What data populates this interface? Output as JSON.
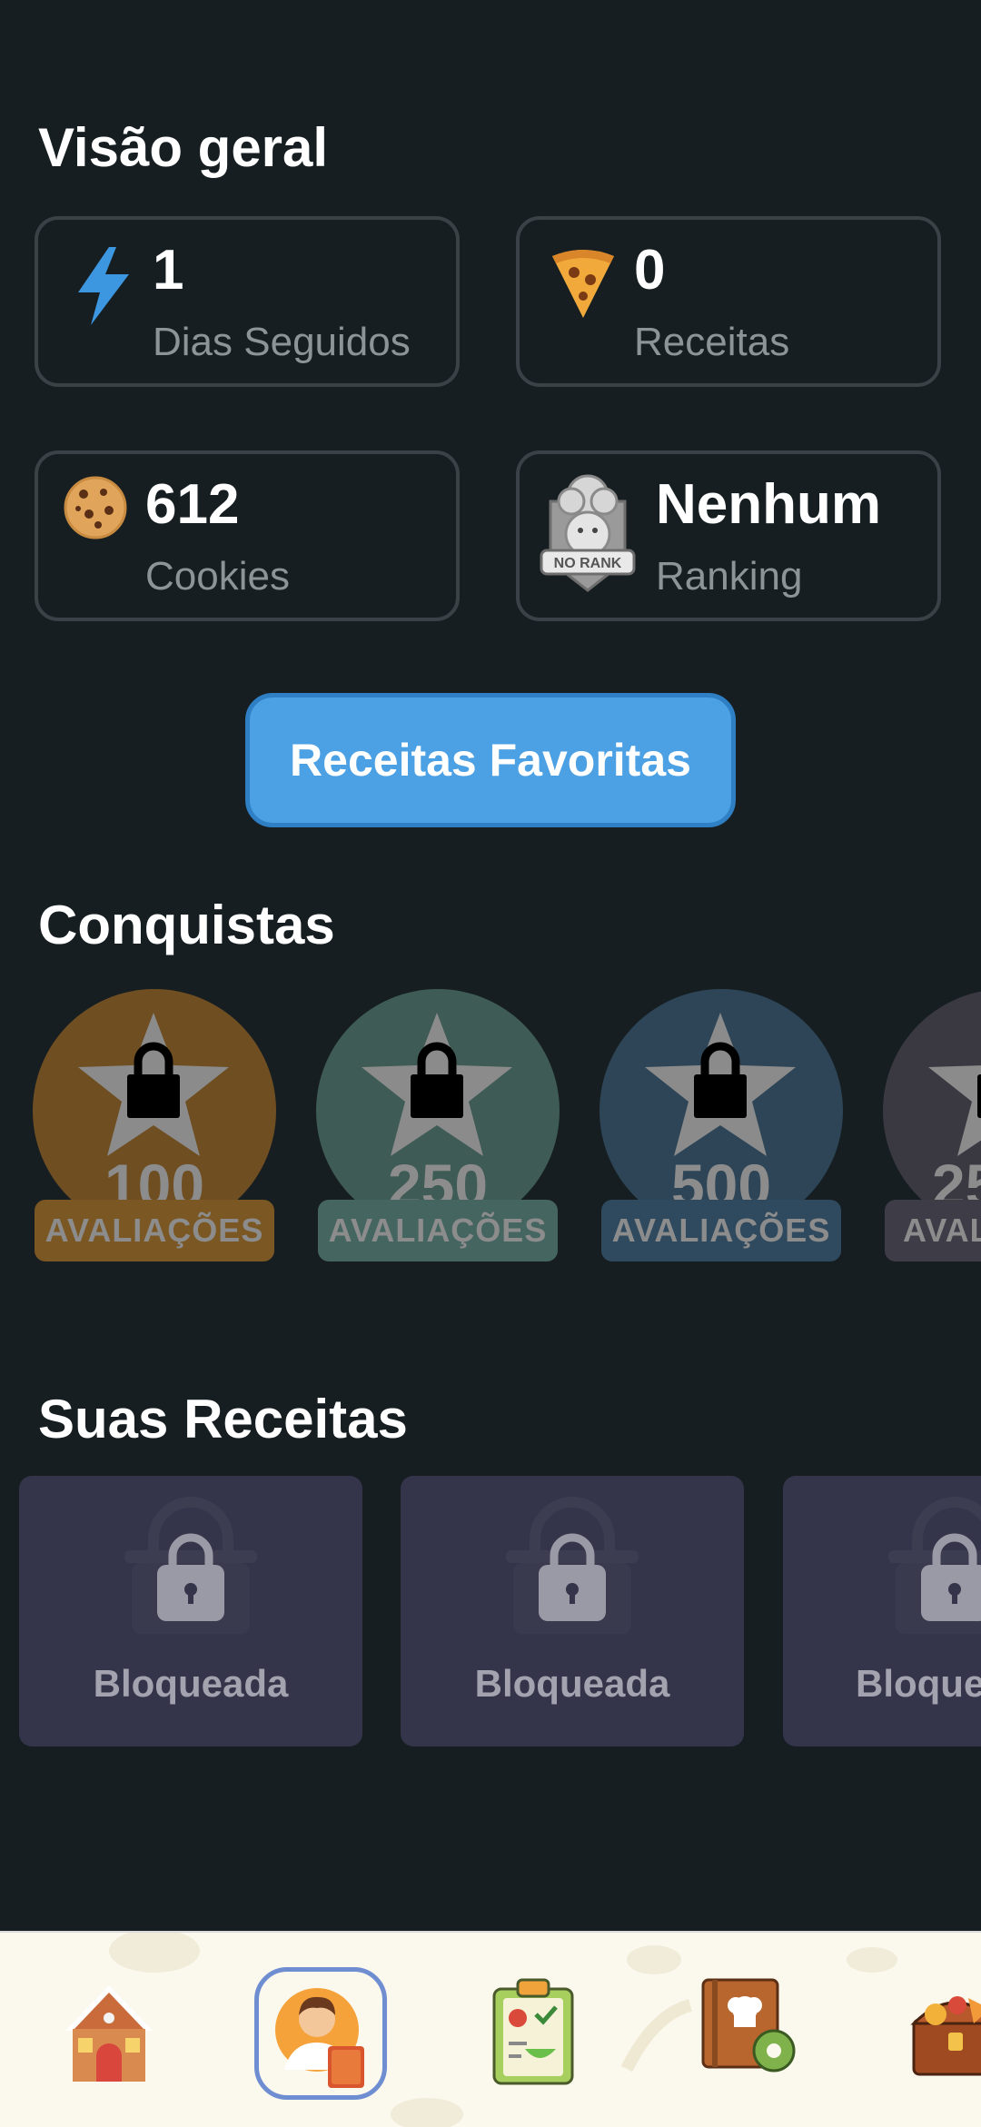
{
  "overview": {
    "title": "Visão geral",
    "stats": [
      {
        "value": "1",
        "label": "Dias Seguidos",
        "icon": "lightning-icon"
      },
      {
        "value": "0",
        "label": "Receitas",
        "icon": "pizza-icon"
      },
      {
        "value": "612",
        "label": "Cookies",
        "icon": "cookie-icon"
      },
      {
        "value": "Nenhum",
        "label": "Ranking",
        "icon": "no-rank-badge-icon",
        "badge_text": "NO RANK"
      }
    ]
  },
  "favorites_button": {
    "label": "Receitas Favoritas"
  },
  "achievements": {
    "title": "Conquistas",
    "badges": [
      {
        "number": "100",
        "label": "AVALIAÇÕES",
        "color": "#6f4e22",
        "ribbon_color": "#7a5723"
      },
      {
        "number": "250",
        "label": "AVALIAÇÕES",
        "color": "#3f5b55",
        "ribbon_color": "#456560"
      },
      {
        "number": "500",
        "label": "AVALIAÇÕES",
        "color": "#2d4556",
        "ribbon_color": "#2f4a5e"
      },
      {
        "number": "25",
        "label": "AVAL",
        "color": "#3a3942",
        "ribbon_color": "#3e3c47"
      }
    ]
  },
  "recipes": {
    "title": "Suas Receitas",
    "items": [
      {
        "label": "Bloqueada"
      },
      {
        "label": "Bloqueada"
      },
      {
        "label": "Bloque"
      }
    ]
  },
  "bottom_nav": {
    "items": [
      {
        "icon": "gingerbread-house-icon",
        "active": false
      },
      {
        "icon": "chef-profile-icon",
        "active": true
      },
      {
        "icon": "checklist-icon",
        "active": false
      },
      {
        "icon": "recipe-book-settings-icon",
        "active": false
      },
      {
        "icon": "treasure-chest-icon",
        "active": false
      }
    ]
  }
}
